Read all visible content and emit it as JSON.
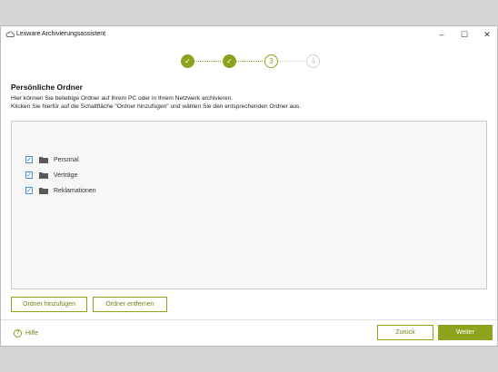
{
  "window": {
    "title": "Lexware Archivierungsassistent",
    "controls": {
      "minimize": "–",
      "maximize": "☐",
      "close": "✕"
    }
  },
  "stepper": {
    "steps": [
      {
        "label": "✓",
        "state": "done"
      },
      {
        "label": "✓",
        "state": "done"
      },
      {
        "label": "3",
        "state": "current"
      },
      {
        "label": "4",
        "state": "upcoming"
      }
    ]
  },
  "page": {
    "heading": "Persönliche Ordner",
    "description_line1": "Hier können Sie beliebige Ordner auf Ihrem PC oder in Ihrem Netzwerk archivieren.",
    "description_line2": "Klicken Sie hierfür auf die Schaltfläche \"Ordner hinzufügen\" und wählen Sie den entsprechenden Ordner aus."
  },
  "folders": [
    {
      "label": "Personal",
      "checked": true
    },
    {
      "label": "Verträge",
      "checked": true
    },
    {
      "label": "Reklamationen",
      "checked": true
    }
  ],
  "actions": {
    "add_label": "Ordner hinzufügen",
    "remove_label": "Ordner entfernen"
  },
  "footer": {
    "help_label": "Hilfe",
    "help_icon": "?",
    "back_label": "Zurück",
    "next_label": "Weiter"
  },
  "colors": {
    "accent": "#8ca31c",
    "checkbox_border": "#4a90d9"
  }
}
